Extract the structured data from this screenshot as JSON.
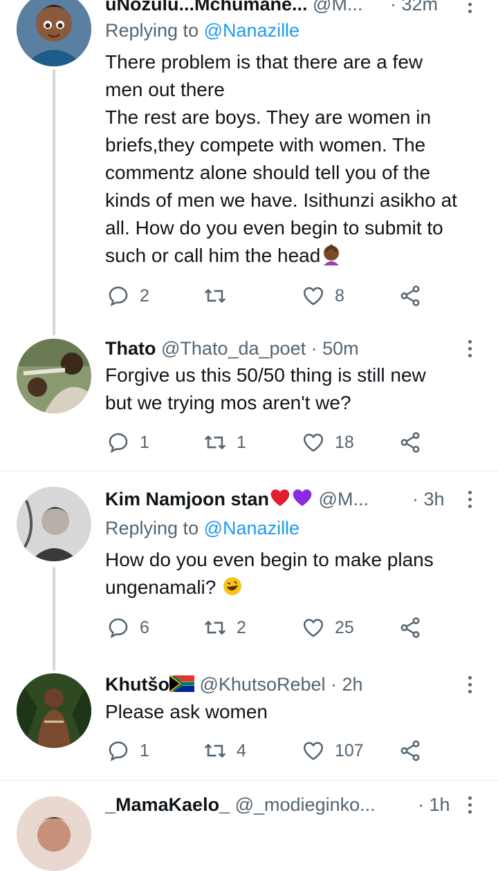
{
  "tweets": [
    {
      "name": "uNozulu...Mchumane...",
      "handle": "@M...",
      "time": "· 32m",
      "replying_prefix": "Replying to",
      "replying_to": "@Nanazille",
      "lines": [
        "There problem is that there are a few",
        "men out there",
        "The rest are boys. They are women in",
        "briefs,they compete with women. The",
        "commentz alone should tell you of the",
        "kinds of men we have. Isithunzi asikho at",
        "all. How do you even begin to submit to",
        "such or call him the head"
      ],
      "replies": "2",
      "retweets": "",
      "likes": "8"
    },
    {
      "name": "Thato",
      "handle": "@Thato_da_poet",
      "time": "· 50m",
      "lines": [
        "Forgive us this 50/50 thing is still new",
        "but we trying mos aren't we?"
      ],
      "replies": "1",
      "retweets": "1",
      "likes": "18"
    },
    {
      "name": "Kim Namjoon stan",
      "handle": "@M...",
      "time": "· 3h",
      "replying_prefix": "Replying to",
      "replying_to": "@Nanazille",
      "lines": [
        "How do you even begin to make plans",
        "ungenamali?"
      ],
      "replies": "6",
      "retweets": "2",
      "likes": "25"
    },
    {
      "name": "Khutšo",
      "handle": "@KhutsoRebel",
      "time": "· 2h",
      "lines": [
        "Please ask women"
      ],
      "replies": "1",
      "retweets": "4",
      "likes": "107"
    },
    {
      "name": "_MamaKaelo_",
      "handle": "@_modieginko...",
      "time": "· 1h"
    }
  ],
  "icons": {
    "reply": "reply-icon",
    "retweet": "retweet-icon",
    "like": "heart-icon",
    "share": "share-icon",
    "more": "more-options-icon"
  },
  "colors": {
    "link": "#1d9bf0",
    "secondary_text": "#536471",
    "thread_line": "#cfd9de",
    "divider": "#eff3f4"
  }
}
